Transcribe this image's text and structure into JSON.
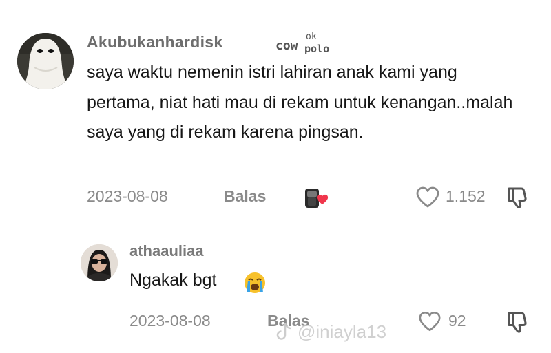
{
  "comment": {
    "username": "Akubukanhardisk",
    "brand_mark": [
      "cow",
      "ok",
      "polo"
    ],
    "text": "saya waktu nemenin istri lahiran anak kami yang pertama, niat hati mau di rekam untuk kenangan..malah saya yang di rekam karena pingsan.",
    "date": "2023-08-08",
    "reply_label": "Balas",
    "likes": "1.152",
    "icons": {
      "avatar": "ghost-avatar",
      "creator_badge": "creator-liked-icon",
      "like": "heart-icon",
      "dislike": "thumbs-down-icon"
    }
  },
  "reply": {
    "username": "athaauliaa",
    "text": "Ngakak bgt",
    "emoji": "loudly-crying-face-icon",
    "date": "2023-08-08",
    "reply_label": "Balas",
    "likes": "92",
    "icons": {
      "like": "heart-icon",
      "dislike": "thumbs-down-icon"
    }
  },
  "watermark": {
    "handle": "@iniayla13",
    "icon": "tiktok-logo-icon"
  },
  "colors": {
    "text": "#161616",
    "muted": "#8a8a8a",
    "heart_red": "#f0364c",
    "emoji_yellow": "#f7c12b",
    "tear_blue": "#3aa3e6"
  }
}
